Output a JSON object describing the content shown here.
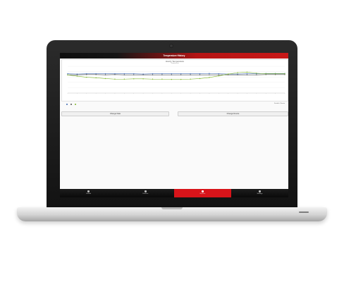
{
  "app": {
    "title": "Temperature History"
  },
  "chart": {
    "title": "Hourly Temperature",
    "subtitle": "Temperature"
  },
  "chart_data": {
    "type": "line",
    "x": [
      1,
      2,
      3,
      4,
      5,
      6,
      7,
      8,
      9,
      10,
      11,
      12,
      13,
      14,
      15,
      16,
      17,
      18,
      19,
      20,
      21,
      22,
      23,
      24
    ],
    "ylim": [
      0,
      100
    ],
    "series": [
      {
        "color": "#3c67b0",
        "values": [
          72,
          71,
          72,
          72,
          72,
          72,
          72,
          72,
          71,
          72,
          72,
          72,
          72,
          72,
          72,
          73,
          72,
          71,
          71,
          72,
          72,
          73,
          73,
          73
        ]
      },
      {
        "color": "#555555",
        "values": [
          68,
          68,
          69,
          69,
          68,
          69,
          68,
          68,
          68,
          68,
          68,
          68,
          68,
          68,
          68,
          68,
          68,
          68,
          68,
          68,
          68,
          69,
          69,
          69
        ]
      },
      {
        "color": "#7fb52c",
        "values": [
          68,
          63,
          59,
          57,
          54,
          52,
          52,
          53,
          53,
          52,
          52,
          51,
          51,
          52,
          54,
          58,
          64,
          71,
          76,
          78,
          74,
          72,
          72,
          72
        ]
      }
    ]
  },
  "legend": {
    "right": "Friedrich Climate"
  },
  "buttons": {
    "change_date": "Change Date",
    "change_device": "Change Device"
  },
  "tabs": [
    {
      "label": "Control"
    },
    {
      "label": "Devices"
    },
    {
      "label": "Reports"
    },
    {
      "label": "Settings"
    }
  ]
}
